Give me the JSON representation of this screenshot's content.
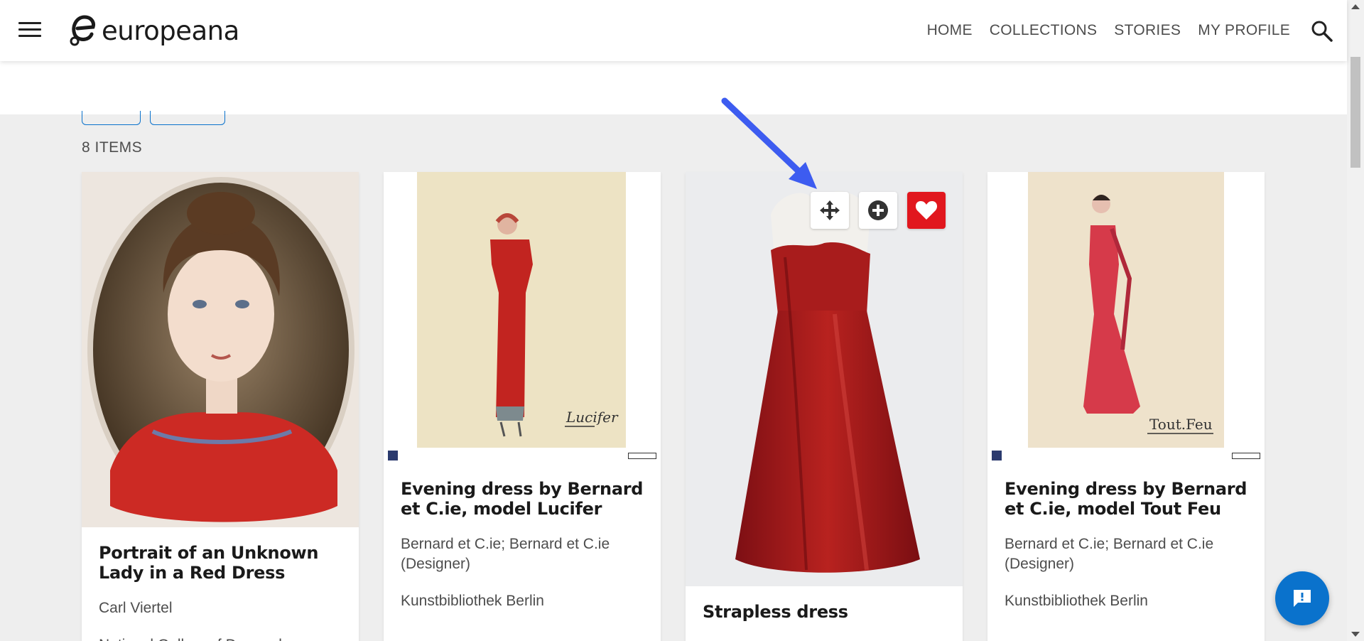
{
  "header": {
    "logo_text": "europeana",
    "nav": [
      "HOME",
      "COLLECTIONS",
      "STORIES",
      "MY PROFILE"
    ]
  },
  "results": {
    "count_label": "8 ITEMS"
  },
  "cards": [
    {
      "title": "Portrait of an Unknown Lady in a Red Dress",
      "creator": "Carl Viertel",
      "provider": "National Gallery of Denmark"
    },
    {
      "title": "Evening dress by Bernard et C.ie, model Lucifer",
      "creator": "Bernard et C.ie; Bernard et C.ie (Designer)",
      "provider": "Kunstbibliothek Berlin",
      "image_caption": "Lucifer"
    },
    {
      "title": "Strapless dress"
    },
    {
      "title": "Evening dress by Bernard et C.ie, model Tout Feu",
      "creator": "Bernard et C.ie; Bernard et C.ie (Designer)",
      "provider": "Kunstbibliothek Berlin",
      "image_caption": "Tout.Feu"
    }
  ],
  "colors": {
    "accent_blue": "#0a72cc",
    "like_red": "#e1171e",
    "arrow_blue": "#3d5cf0"
  }
}
